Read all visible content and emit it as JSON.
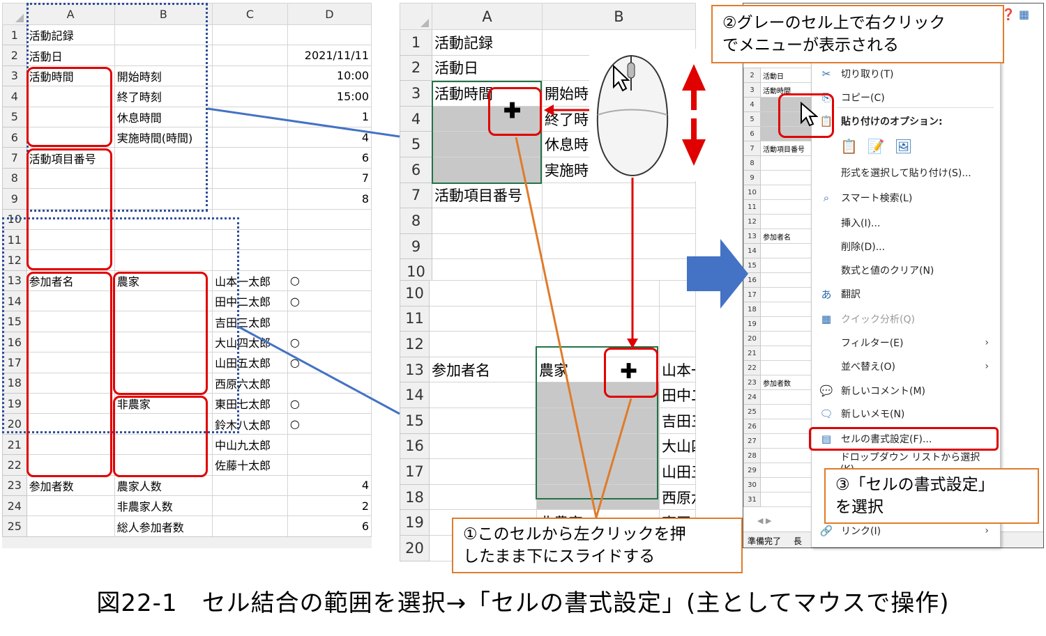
{
  "sheet1": {
    "col_headers": [
      "A",
      "B",
      "C",
      "D"
    ],
    "rows": [
      {
        "n": "1",
        "a": "活動記録",
        "b": "",
        "c": "",
        "d": ""
      },
      {
        "n": "2",
        "a": "活動日",
        "b": "",
        "c": "",
        "d": "2021/11/11"
      },
      {
        "n": "3",
        "a": "活動時間",
        "b": "開始時刻",
        "c": "",
        "d": "10:00"
      },
      {
        "n": "4",
        "a": "",
        "b": "終了時刻",
        "c": "",
        "d": "15:00"
      },
      {
        "n": "5",
        "a": "",
        "b": "休息時間",
        "c": "",
        "d": "1"
      },
      {
        "n": "6",
        "a": "",
        "b": "実施時間(時間)",
        "c": "",
        "d": "4"
      },
      {
        "n": "7",
        "a": "活動項目番号",
        "b": "",
        "c": "",
        "d": "6"
      },
      {
        "n": "8",
        "a": "",
        "b": "",
        "c": "",
        "d": "7"
      },
      {
        "n": "9",
        "a": "",
        "b": "",
        "c": "",
        "d": "8"
      },
      {
        "n": "10",
        "a": "",
        "b": "",
        "c": "",
        "d": ""
      },
      {
        "n": "11",
        "a": "",
        "b": "",
        "c": "",
        "d": ""
      },
      {
        "n": "12",
        "a": "",
        "b": "",
        "c": "",
        "d": ""
      },
      {
        "n": "13",
        "a": "参加者名",
        "b": "農家",
        "c": "山本一太郎",
        "d": "○"
      },
      {
        "n": "14",
        "a": "",
        "b": "",
        "c": "田中二太郎",
        "d": "○"
      },
      {
        "n": "15",
        "a": "",
        "b": "",
        "c": "吉田三太郎",
        "d": ""
      },
      {
        "n": "16",
        "a": "",
        "b": "",
        "c": "大山四太郎",
        "d": "○"
      },
      {
        "n": "17",
        "a": "",
        "b": "",
        "c": "山田五太郎",
        "d": "○"
      },
      {
        "n": "18",
        "a": "",
        "b": "",
        "c": "西原六太郎",
        "d": ""
      },
      {
        "n": "19",
        "a": "",
        "b": "非農家",
        "c": "東田七太郎",
        "d": "○"
      },
      {
        "n": "20",
        "a": "",
        "b": "",
        "c": "鈴木八太郎",
        "d": "○"
      },
      {
        "n": "21",
        "a": "",
        "b": "",
        "c": "中山九太郎",
        "d": ""
      },
      {
        "n": "22",
        "a": "",
        "b": "",
        "c": "佐藤十太郎",
        "d": ""
      },
      {
        "n": "23",
        "a": "参加者数",
        "b": "農家人数",
        "c": "",
        "d": "4"
      },
      {
        "n": "24",
        "a": "",
        "b": "非農家人数",
        "c": "",
        "d": "2"
      },
      {
        "n": "25",
        "a": "",
        "b": "総人参加者数",
        "c": "",
        "d": "6"
      }
    ]
  },
  "zoom_top": {
    "col_headers": [
      "A",
      "B"
    ],
    "rows": [
      {
        "n": "1",
        "a": "活動記録",
        "b": ""
      },
      {
        "n": "2",
        "a": "活動日",
        "b": ""
      },
      {
        "n": "3",
        "a": "活動時間",
        "b": "開始時"
      },
      {
        "n": "4",
        "a": "",
        "b": "終了時"
      },
      {
        "n": "5",
        "a": "",
        "b": "休息時"
      },
      {
        "n": "6",
        "a": "",
        "b": "実施時"
      },
      {
        "n": "7",
        "a": "活動項目番号",
        "b": ""
      },
      {
        "n": "8",
        "a": "",
        "b": ""
      },
      {
        "n": "9",
        "a": "",
        "b": ""
      },
      {
        "n": "10",
        "a": "",
        "b": ""
      }
    ]
  },
  "zoom_bottom": {
    "rows": [
      {
        "n": "10",
        "a": "",
        "b": "",
        "c": ""
      },
      {
        "n": "11",
        "a": "",
        "b": "",
        "c": ""
      },
      {
        "n": "12",
        "a": "",
        "b": "",
        "c": ""
      },
      {
        "n": "13",
        "a": "参加者名",
        "b": "農家",
        "c": "山本一"
      },
      {
        "n": "14",
        "a": "",
        "b": "",
        "c": "田中二"
      },
      {
        "n": "15",
        "a": "",
        "b": "",
        "c": "吉田三"
      },
      {
        "n": "16",
        "a": "",
        "b": "",
        "c": "大山四"
      },
      {
        "n": "17",
        "a": "",
        "b": "",
        "c": "山田五"
      },
      {
        "n": "18",
        "a": "",
        "b": "",
        "c": "西原六"
      },
      {
        "n": "19",
        "a": "",
        "b": "非農家",
        "c": "東田七"
      },
      {
        "n": "20",
        "a": "",
        "b": "",
        "c": ""
      }
    ]
  },
  "right_sheet": {
    "rows": [
      {
        "n": "2",
        "a": "活動日"
      },
      {
        "n": "3",
        "a": "活動時間"
      },
      {
        "n": "4",
        "a": ""
      },
      {
        "n": "5",
        "a": ""
      },
      {
        "n": "6",
        "a": ""
      },
      {
        "n": "7",
        "a": "活動項目番号"
      },
      {
        "n": "8",
        "a": ""
      },
      {
        "n": "9",
        "a": ""
      },
      {
        "n": "10",
        "a": ""
      },
      {
        "n": "11",
        "a": ""
      },
      {
        "n": "12",
        "a": ""
      },
      {
        "n": "13",
        "a": "参加者名"
      },
      {
        "n": "14",
        "a": ""
      },
      {
        "n": "15",
        "a": ""
      },
      {
        "n": "16",
        "a": ""
      },
      {
        "n": "17",
        "a": ""
      },
      {
        "n": "18",
        "a": ""
      },
      {
        "n": "19",
        "a": ""
      },
      {
        "n": "20",
        "a": ""
      },
      {
        "n": "21",
        "a": ""
      },
      {
        "n": "22",
        "a": ""
      },
      {
        "n": "23",
        "a": "参加者数"
      },
      {
        "n": "24",
        "a": ""
      },
      {
        "n": "25",
        "a": ""
      },
      {
        "n": "26",
        "a": ""
      },
      {
        "n": "27",
        "a": ""
      },
      {
        "n": "28",
        "a": ""
      },
      {
        "n": "29",
        "a": ""
      },
      {
        "n": "30",
        "a": ""
      },
      {
        "n": "31",
        "a": ""
      }
    ],
    "status_ready": "準備完了",
    "status_extra": "長"
  },
  "context_menu": {
    "items": [
      {
        "icon": "✂",
        "icon_name": "cut-icon",
        "label": "切り取り(T)",
        "arrow": ""
      },
      {
        "icon": "⎘",
        "icon_name": "copy-icon",
        "label": "コピー(C)",
        "arrow": ""
      },
      {
        "icon": "📋",
        "icon_name": "paste-icon",
        "label": "貼り付けのオプション:",
        "arrow": ""
      },
      {
        "icon": "",
        "icon_name": "",
        "label": "形式を選択して貼り付け(S)...",
        "arrow": ""
      },
      {
        "icon": "⌕",
        "icon_name": "smart-lookup-icon",
        "label": "スマート検索(L)",
        "arrow": ""
      },
      {
        "icon": "",
        "icon_name": "",
        "label": "挿入(I)...",
        "arrow": ""
      },
      {
        "icon": "",
        "icon_name": "",
        "label": "削除(D)...",
        "arrow": ""
      },
      {
        "icon": "",
        "icon_name": "",
        "label": "数式と値のクリア(N)",
        "arrow": ""
      },
      {
        "icon": "あ",
        "icon_name": "translate-icon",
        "label": "翻訳",
        "arrow": ""
      },
      {
        "icon": "▦",
        "icon_name": "quick-analysis-icon",
        "label": "クイック分析(Q)",
        "arrow": ""
      },
      {
        "icon": "",
        "icon_name": "",
        "label": "フィルター(E)",
        "arrow": "›"
      },
      {
        "icon": "",
        "icon_name": "",
        "label": "並べ替え(O)",
        "arrow": "›"
      },
      {
        "icon": "💬",
        "icon_name": "new-comment-icon",
        "label": "新しいコメント(M)",
        "arrow": ""
      },
      {
        "icon": "🗨",
        "icon_name": "new-note-icon",
        "label": "新しいメモ(N)",
        "arrow": ""
      },
      {
        "icon": "▤",
        "icon_name": "format-cells-icon",
        "label": "セルの書式設定(F)...",
        "arrow": ""
      },
      {
        "icon": "",
        "icon_name": "",
        "label": "ドロップダウン リストから選択(K)...",
        "arrow": ""
      },
      {
        "icon": "",
        "icon_name": "",
        "label": "",
        "arrow": ""
      },
      {
        "icon": "🔗",
        "icon_name": "link-icon",
        "label": "リンク(I)",
        "arrow": "›"
      }
    ]
  },
  "callouts": {
    "step2": "②グレーのセル上で右クリック\nでメニューが表示される",
    "step3": "③「セルの書式設定」\nを選択",
    "step1": "①このセルから左クリックを押\nしたまま下にスライドする"
  },
  "caption": "図22-1　セル結合の範囲を選択→「セルの書式設定」(主としてマウスで操作)",
  "colors": {
    "red": "#e00000",
    "orange": "#e07b2a",
    "blue": "#4472c4",
    "gray_cell": "#c8c8c8"
  }
}
